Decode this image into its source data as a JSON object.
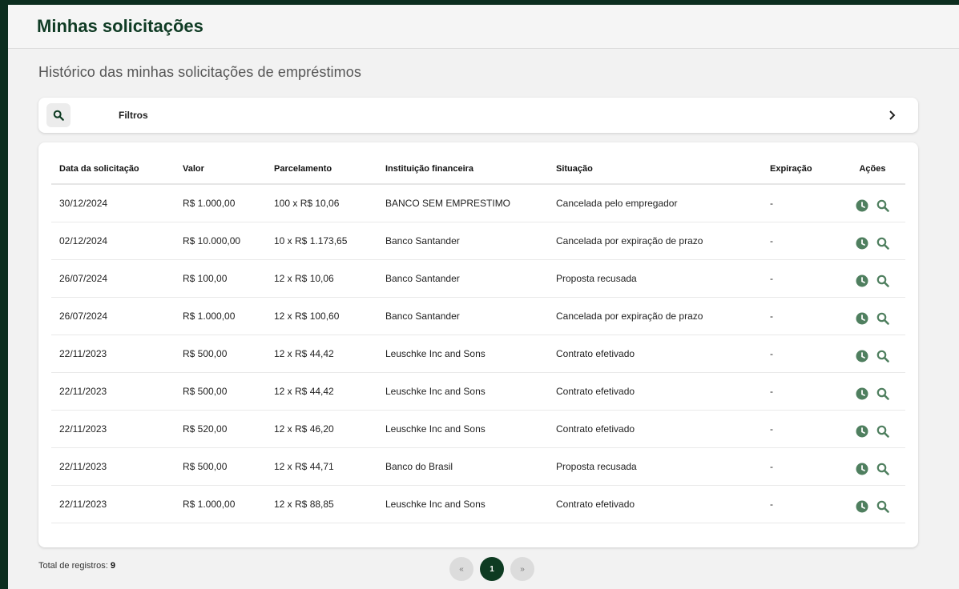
{
  "header": {
    "title": "Minhas solicitações"
  },
  "subtitle": "Histórico das minhas solicitações de empréstimos",
  "filters": {
    "label": "Filtros"
  },
  "table": {
    "columns": [
      "Data da solicitação",
      "Valor",
      "Parcelamento",
      "Instituição financeira",
      "Situação",
      "Expiração",
      "Ações"
    ],
    "rows": [
      [
        "30/12/2024",
        "R$ 1.000,00",
        "100 x R$ 10,06",
        "BANCO SEM EMPRESTIMO",
        "Cancelada pelo empregador",
        "-"
      ],
      [
        "02/12/2024",
        "R$ 10.000,00",
        "10 x R$ 1.173,65",
        "Banco Santander",
        "Cancelada por expiração de prazo",
        "-"
      ],
      [
        "26/07/2024",
        "R$ 100,00",
        "12 x R$ 10,06",
        "Banco Santander",
        "Proposta recusada",
        "-"
      ],
      [
        "26/07/2024",
        "R$ 1.000,00",
        "12 x R$ 100,60",
        "Banco Santander",
        "Cancelada por expiração de prazo",
        "-"
      ],
      [
        "22/11/2023",
        "R$ 500,00",
        "12 x R$ 44,42",
        "Leuschke Inc and Sons",
        "Contrato efetivado",
        "-"
      ],
      [
        "22/11/2023",
        "R$ 500,00",
        "12 x R$ 44,42",
        "Leuschke Inc and Sons",
        "Contrato efetivado",
        "-"
      ],
      [
        "22/11/2023",
        "R$ 520,00",
        "12 x R$ 46,20",
        "Leuschke Inc and Sons",
        "Contrato efetivado",
        "-"
      ],
      [
        "22/11/2023",
        "R$ 500,00",
        "12 x R$ 44,71",
        "Banco do Brasil",
        "Proposta recusada",
        "-"
      ],
      [
        "22/11/2023",
        "R$ 1.000,00",
        "12 x R$ 88,85",
        "Leuschke Inc and Sons",
        "Contrato efetivado",
        "-"
      ]
    ]
  },
  "footer": {
    "total_label": "Total de registros:",
    "total_value": "9",
    "pager": {
      "prev": "«",
      "current": "1",
      "next": "»"
    }
  },
  "icons": {
    "filter_search": "search-icon",
    "filter_expand": "chevron-right-icon",
    "row_history": "clock-icon",
    "row_view": "search-icon"
  },
  "colors": {
    "brand": "#0e3b22",
    "icon_green": "#4f7f5f",
    "background": "#0c2e1f"
  }
}
